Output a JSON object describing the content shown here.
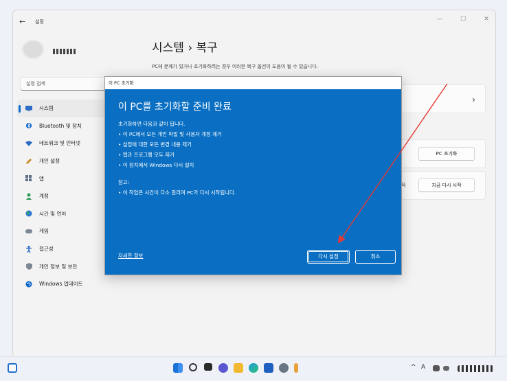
{
  "window": {
    "back": "←",
    "title": "설정",
    "controls": [
      "—",
      "☐",
      "✕"
    ]
  },
  "search": {
    "placeholder": "설정 검색"
  },
  "nav": [
    {
      "label": "시스템",
      "icon": "monitor-icon",
      "active": true
    },
    {
      "label": "Bluetooth 및 장치",
      "icon": "bluetooth-icon"
    },
    {
      "label": "네트워크 및 인터넷",
      "icon": "wifi-icon"
    },
    {
      "label": "개인 설정",
      "icon": "pencil-icon"
    },
    {
      "label": "앱",
      "icon": "apps-icon"
    },
    {
      "label": "계정",
      "icon": "person-icon"
    },
    {
      "label": "시간 및 언어",
      "icon": "globe-icon"
    },
    {
      "label": "게임",
      "icon": "gamepad-icon"
    },
    {
      "label": "접근성",
      "icon": "accessibility-icon"
    },
    {
      "label": "개인 정보 및 보안",
      "icon": "shield-icon"
    },
    {
      "label": "Windows 업데이트",
      "icon": "update-icon"
    }
  ],
  "page": {
    "title": "시스템 › 복구",
    "description": "PC에 문제가 있거나 초기화하려는 경우 이러한 복구 옵션이 도움이 될 수 있습니다."
  },
  "cards": {
    "chevron": "›",
    "reset_button": "PC 초기화",
    "restart_partial": "작",
    "restart_button": "지금 다시 시작"
  },
  "dialog": {
    "window_title": "이 PC 초기화",
    "heading": "이 PC를 초기화할 준비 완료",
    "intro": "초기화하면 다음과 같이 됩니다.",
    "items": [
      "• 이 PC에서 모든 개인 파일 및 사용자 계정 제거",
      "• 설정에 대한 모든 변경 내용 제거",
      "• 앱과 프로그램 모두 제거",
      "• 이 장치에서 Windows 다시 설치"
    ],
    "note_label": "참고:",
    "note": "• 이 작업은 시간이 다소 걸리며 PC가 다시 시작됩니다.",
    "more_info": "자세한 정보",
    "reset_button": "다시 설정",
    "cancel_button": "취소"
  },
  "taskbar": {
    "tray_chevron": "^",
    "ime": "A"
  },
  "colors": {
    "accent": "#0a6fc2",
    "annotation_arrow": "#e53935"
  }
}
